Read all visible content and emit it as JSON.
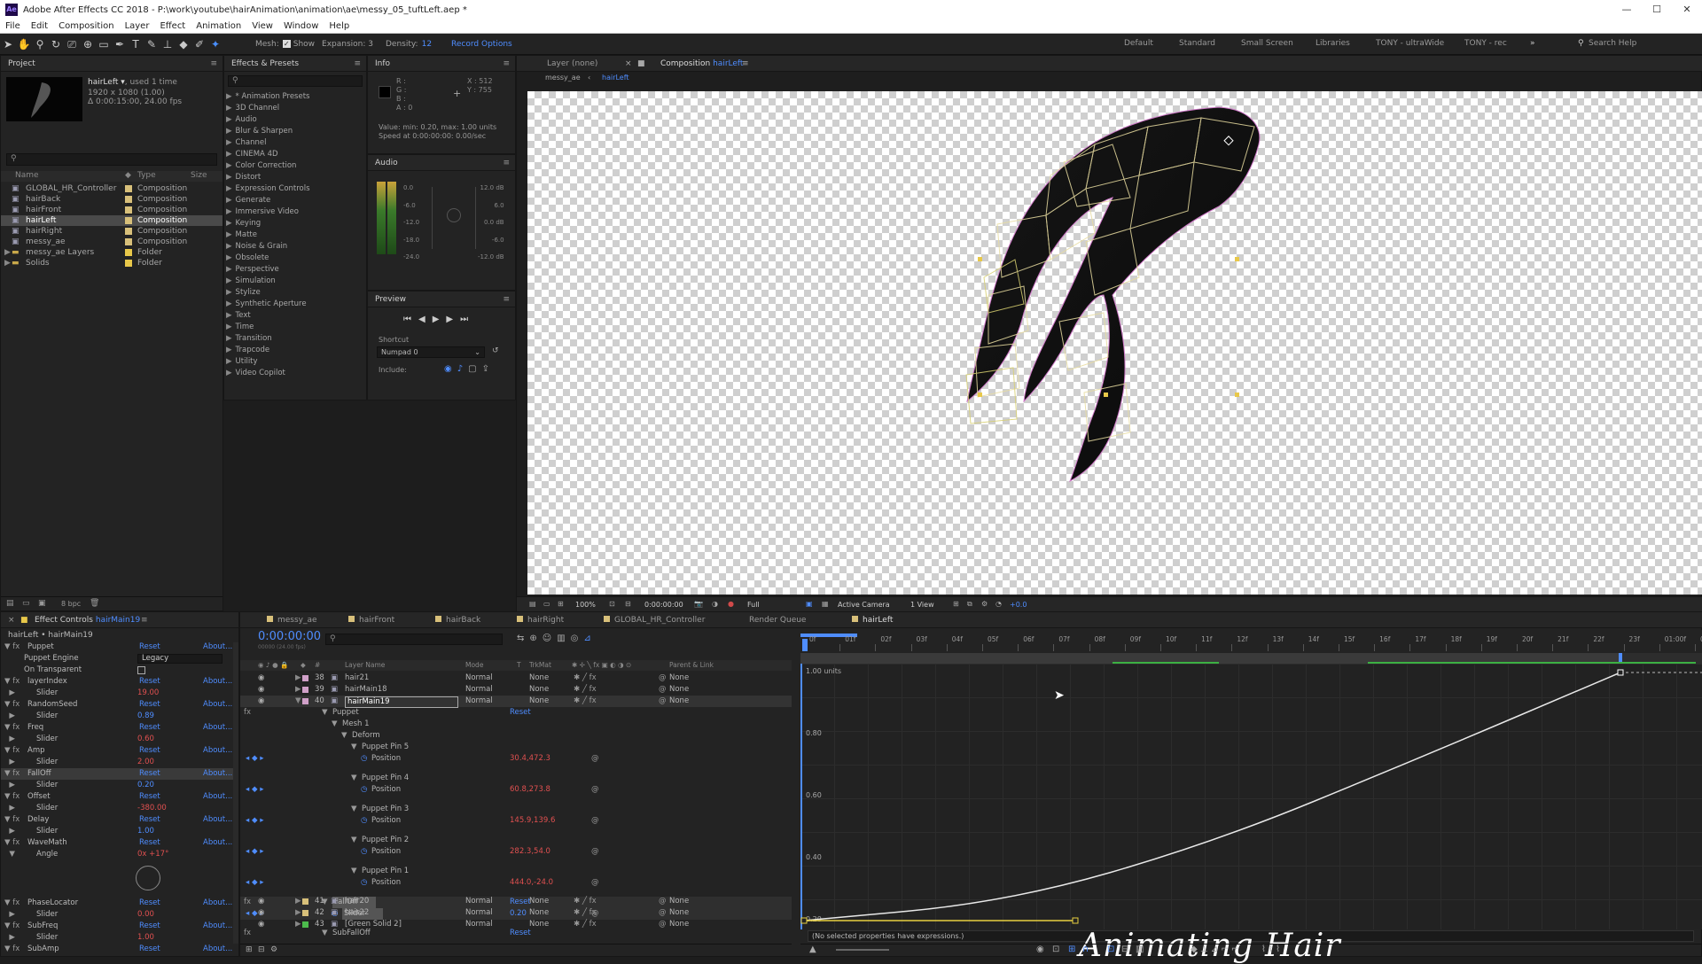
{
  "app": {
    "title": "Adobe After Effects CC 2018 - P:\\work\\youtube\\hairAnimation\\animation\\ae\\messy_05_tuftLeft.aep *",
    "menus": [
      "File",
      "Edit",
      "Composition",
      "Layer",
      "Effect",
      "Animation",
      "View",
      "Window",
      "Help"
    ],
    "window_controls": [
      "—",
      "☐",
      "✕"
    ]
  },
  "toolbar": {
    "mesh_label": "Mesh:",
    "show_label": "Show",
    "expansion": "Expansion: 3",
    "density_label": "Density:",
    "density_value": "12",
    "record_options": "Record Options",
    "workspaces": [
      "Default",
      "Standard",
      "Small Screen",
      "Libraries",
      "TONY - ultraWide",
      "TONY - rec"
    ],
    "search": "Search Help"
  },
  "project": {
    "header": "Project",
    "comp_name": "hairLeft ▾",
    "used": ", used 1 time",
    "size": "1920 x 1080 (1.00)",
    "duration": "Δ 0:00:15:00, 24.00 fps",
    "columns": [
      "Name",
      "Type",
      "Size"
    ],
    "items": [
      {
        "name": "GLOBAL_HR_Controller",
        "type": "Composition",
        "color": "#d8c07a"
      },
      {
        "name": "hairBack",
        "type": "Composition",
        "color": "#d8c07a"
      },
      {
        "name": "hairFront",
        "type": "Composition",
        "color": "#d8c07a"
      },
      {
        "name": "hairLeft",
        "type": "Composition",
        "color": "#d8c07a"
      },
      {
        "name": "hairRight",
        "type": "Composition",
        "color": "#d8c07a"
      },
      {
        "name": "messy_ae",
        "type": "Composition",
        "color": "#d8c07a"
      },
      {
        "name": "messy_ae Layers",
        "type": "Folder",
        "color": "#e8c84a"
      },
      {
        "name": "Solids",
        "type": "Folder",
        "color": "#e8c84a"
      }
    ],
    "bpc": "8 bpc"
  },
  "effects": {
    "header": "Effects & Presets",
    "items": [
      "* Animation Presets",
      "3D Channel",
      "Audio",
      "Blur & Sharpen",
      "Channel",
      "CINEMA 4D",
      "Color Correction",
      "Distort",
      "Expression Controls",
      "Generate",
      "Immersive Video",
      "Keying",
      "Matte",
      "Noise & Grain",
      "Obsolete",
      "Perspective",
      "Simulation",
      "Stylize",
      "Synthetic Aperture",
      "Text",
      "Time",
      "Transition",
      "Trapcode",
      "Utility",
      "Video Copilot"
    ]
  },
  "info": {
    "header": "Info",
    "r": "R :",
    "g": "G :",
    "b": "B :",
    "a": "A : 0",
    "x": "X : 512",
    "y": "Y : 755",
    "line1": "Value: min: 0.20, max: 1.00 units",
    "line2": "Speed at 0:00:00:00: 0.00/sec"
  },
  "audio": {
    "header": "Audio",
    "left_scale": [
      "0.0",
      "-6.0",
      "-12.0",
      "-18.0",
      "-24.0"
    ],
    "right_scale": [
      "12.0 dB",
      "6.0",
      "0.0 dB",
      "-6.0",
      "-12.0 dB"
    ]
  },
  "preview": {
    "header": "Preview",
    "shortcut_label": "Shortcut",
    "shortcut_value": "Numpad 0",
    "include_label": "Include:"
  },
  "comp_viewer": {
    "layer_tab": "Layer (none)",
    "comp_tab_prefix": "Composition",
    "comp_tab_name": "hairLeft",
    "crumbs": [
      "messy_ae",
      "hairLeft"
    ],
    "zoom": "100%",
    "timecode": "0:00:00:00",
    "quality": "Full",
    "camera": "Active Camera",
    "views": "1 View",
    "offset": "+0.0"
  },
  "effect_controls": {
    "header_prefix": "Effect Controls",
    "header_layer": "hairMain19",
    "layer_path": "hairLeft • hairMain19",
    "rows": [
      {
        "ind": "▼ fx",
        "label": "Puppet",
        "reset": "Reset",
        "about": "About..."
      },
      {
        "ind": "",
        "label": "Puppet Engine",
        "value": "Legacy",
        "kind": "dropdown"
      },
      {
        "ind": "",
        "label": "On Transparent",
        "kind": "checkbox"
      },
      {
        "ind": "▼ fx",
        "label": "layerIndex",
        "reset": "Reset",
        "about": "About..."
      },
      {
        "ind": "  ▶",
        "label": "Slider",
        "value": "19.00",
        "vc": "red"
      },
      {
        "ind": "▼ fx",
        "label": "RandomSeed",
        "reset": "Reset",
        "about": "About..."
      },
      {
        "ind": "  ▶",
        "label": "Slider",
        "value": "0.89",
        "vc": "blue"
      },
      {
        "ind": "▼ fx",
        "label": "Freq",
        "reset": "Reset",
        "about": "About..."
      },
      {
        "ind": "  ▶",
        "label": "Slider",
        "value": "0.60",
        "vc": "red"
      },
      {
        "ind": "▼ fx",
        "label": "Amp",
        "reset": "Reset",
        "about": "About..."
      },
      {
        "ind": "  ▶",
        "label": "Slider",
        "value": "2.00",
        "vc": "red"
      },
      {
        "ind": "▼ fx",
        "label": "FallOff",
        "reset": "Reset",
        "about": "About...",
        "sel": true
      },
      {
        "ind": "  ▶",
        "label": "Slider",
        "value": "0.20",
        "vc": "blue"
      },
      {
        "ind": "▼ fx",
        "label": "Offset",
        "reset": "Reset",
        "about": "About..."
      },
      {
        "ind": "  ▶",
        "label": "Slider",
        "value": "-380.00",
        "vc": "red"
      },
      {
        "ind": "▼ fx",
        "label": "Delay",
        "reset": "Reset",
        "about": "About..."
      },
      {
        "ind": "  ▶",
        "label": "Slider",
        "value": "1.00",
        "vc": "blue"
      },
      {
        "ind": "▼ fx",
        "label": "WaveMath",
        "reset": "Reset",
        "about": "About..."
      },
      {
        "ind": "  ▼",
        "label": "Angle",
        "value": "0x +17°",
        "vc": "red"
      },
      {
        "ind": "",
        "label": "",
        "kind": "dial"
      },
      {
        "ind": "▼ fx",
        "label": "PhaseLocator",
        "reset": "Reset",
        "about": "About..."
      },
      {
        "ind": "  ▶",
        "label": "Slider",
        "value": "0.00",
        "vc": "red"
      },
      {
        "ind": "▼ fx",
        "label": "SubFreq",
        "reset": "Reset",
        "about": "About..."
      },
      {
        "ind": "  ▶",
        "label": "Slider",
        "value": "1.00",
        "vc": "red"
      },
      {
        "ind": "▼ fx",
        "label": "SubAmp",
        "reset": "Reset",
        "about": "About..."
      }
    ]
  },
  "timeline": {
    "tabs": [
      "messy_ae",
      "hairFront",
      "hairBack",
      "hairRight",
      "GLOBAL_HR_Controller",
      "Render Queue",
      "hairLeft"
    ],
    "timecode": "0:00:00:00",
    "timecode_sub": "00000 (24.00 fps)",
    "columns": [
      "#",
      "Layer Name",
      "Mode",
      "T",
      "TrkMat",
      "Parent & Link"
    ],
    "layers": [
      {
        "num": "38",
        "name": "hair21",
        "mode": "Normal",
        "trk": "None",
        "parent": "None"
      },
      {
        "num": "39",
        "name": "hairMain18",
        "mode": "Normal",
        "trk": "None",
        "parent": "None"
      },
      {
        "num": "40",
        "name": "hairMain19",
        "mode": "Normal",
        "trk": "None",
        "parent": "None",
        "sel": true
      }
    ],
    "tree": [
      {
        "indent": 0,
        "label": "Puppet",
        "extra": "Reset",
        "kind": "group"
      },
      {
        "indent": 1,
        "label": "Mesh 1",
        "kind": "group"
      },
      {
        "indent": 2,
        "label": "Deform",
        "kind": "group"
      },
      {
        "indent": 3,
        "label": "Puppet Pin 5",
        "kind": "group"
      },
      {
        "indent": 4,
        "label": "Position",
        "value": "30.4,472.3",
        "kind": "prop"
      },
      {
        "indent": 3,
        "label": "Puppet Pin 4",
        "kind": "group"
      },
      {
        "indent": 4,
        "label": "Position",
        "value": "60.8,273.8",
        "kind": "prop"
      },
      {
        "indent": 3,
        "label": "Puppet Pin 3",
        "kind": "group"
      },
      {
        "indent": 4,
        "label": "Position",
        "value": "145.9,139.6",
        "kind": "prop"
      },
      {
        "indent": 3,
        "label": "Puppet Pin 2",
        "kind": "group"
      },
      {
        "indent": 4,
        "label": "Position",
        "value": "282.3,54.0",
        "kind": "prop"
      },
      {
        "indent": 3,
        "label": "Puppet Pin 1",
        "kind": "group"
      },
      {
        "indent": 4,
        "label": "Position",
        "value": "444.0,-24.0",
        "kind": "prop"
      },
      {
        "indent": 0,
        "label": "FallOff",
        "extra": "Reset",
        "kind": "group",
        "sel": true
      },
      {
        "indent": 1,
        "label": "Slider",
        "value": "0.20",
        "kind": "prop",
        "sel": true,
        "vc": "blue"
      },
      {
        "indent": 0,
        "label": "SubFallOff",
        "extra": "Reset",
        "kind": "group"
      },
      {
        "indent": 1,
        "label": "Slider",
        "value": "0.20",
        "kind": "prop",
        "vc": "blue"
      }
    ],
    "bottom_layers": [
      {
        "num": "41",
        "name": "hair20",
        "mode": "Normal",
        "trk": "None",
        "parent": "None",
        "color": "#d8c07a"
      },
      {
        "num": "42",
        "name": "hair22",
        "mode": "Normal",
        "trk": "None",
        "parent": "None",
        "color": "#d8c07a"
      },
      {
        "num": "43",
        "name": "[Green Solid 2]",
        "mode": "Normal",
        "trk": "None",
        "parent": "None",
        "color": "#4cbb4c"
      }
    ],
    "ruler": [
      "0f",
      "01f",
      "02f",
      "03f",
      "04f",
      "05f",
      "06f",
      "07f",
      "08f",
      "09f",
      "10f",
      "11f",
      "12f",
      "13f",
      "14f",
      "15f",
      "16f",
      "17f",
      "18f",
      "19f",
      "20f",
      "21f",
      "22f",
      "23f",
      "01:00f",
      "01f"
    ],
    "graph_labels": [
      "1.00 units",
      "0.80",
      "0.60",
      "0.40",
      "0.20"
    ],
    "graph_curve": [
      [
        0,
        0.2
      ],
      [
        0.25,
        0.26
      ],
      [
        0.5,
        0.45
      ],
      [
        0.75,
        0.72
      ],
      [
        1,
        1.0
      ]
    ],
    "expression_msg": "(No selected properties have expressions.)"
  },
  "watermark": "Animating Hair"
}
